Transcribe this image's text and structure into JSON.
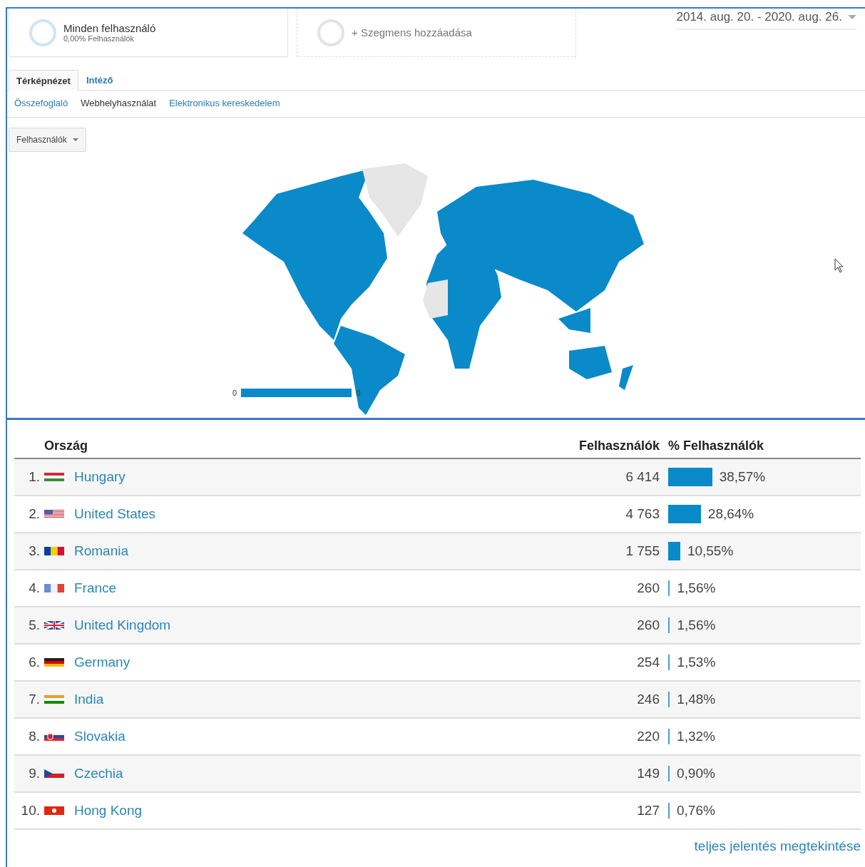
{
  "segments": [
    {
      "kind": "active",
      "title": "Minden felhasználó",
      "subtitle": "0,00% Felhasználók"
    },
    {
      "kind": "add",
      "title": "+ Szegmens hozzáadása"
    }
  ],
  "date_range": "2014. aug. 20. - 2020. aug. 26.",
  "tabs": [
    {
      "label": "Térképnézet",
      "selected": true
    },
    {
      "label": "Intéző",
      "selected": false
    }
  ],
  "subtabs": [
    {
      "label": "Összefoglaló",
      "selected": false
    },
    {
      "label": "Webhelyhasználat",
      "selected": true
    },
    {
      "label": "Elektronikus kereskedelem",
      "selected": false
    }
  ],
  "metric_dropdown": "Felhasználók",
  "map": {
    "legend_min": "0",
    "legend_max": "0"
  },
  "table": {
    "columns": [
      "Ország",
      "Felhasználók",
      "% Felhasználók"
    ],
    "rows": [
      {
        "rank": "1.",
        "kind": "hu",
        "country": "Hungary",
        "users": "6 414",
        "percent": "38,57%"
      },
      {
        "rank": "2.",
        "kind": "us",
        "country": "United States",
        "users": "4 763",
        "percent": "28,64%"
      },
      {
        "rank": "3.",
        "kind": "ro",
        "country": "Romania",
        "users": "1 755",
        "percent": "10,55%"
      },
      {
        "rank": "4.",
        "kind": "fr",
        "country": "France",
        "users": "260",
        "percent": "1,56%"
      },
      {
        "rank": "5.",
        "kind": "gb",
        "country": "United Kingdom",
        "users": "260",
        "percent": "1,56%"
      },
      {
        "rank": "6.",
        "kind": "de",
        "country": "Germany",
        "users": "254",
        "percent": "1,53%"
      },
      {
        "rank": "7.",
        "kind": "in",
        "country": "India",
        "users": "246",
        "percent": "1,48%"
      },
      {
        "rank": "8.",
        "kind": "sk",
        "country": "Slovakia",
        "users": "220",
        "percent": "1,32%"
      },
      {
        "rank": "9.",
        "kind": "cz",
        "country": "Czechia",
        "users": "149",
        "percent": "0,90%"
      },
      {
        "rank": "10.",
        "kind": "hk",
        "country": "Hong Kong",
        "users": "127",
        "percent": "0,76%"
      }
    ]
  },
  "full_report_link": "teljes jelentés megtekintése"
}
